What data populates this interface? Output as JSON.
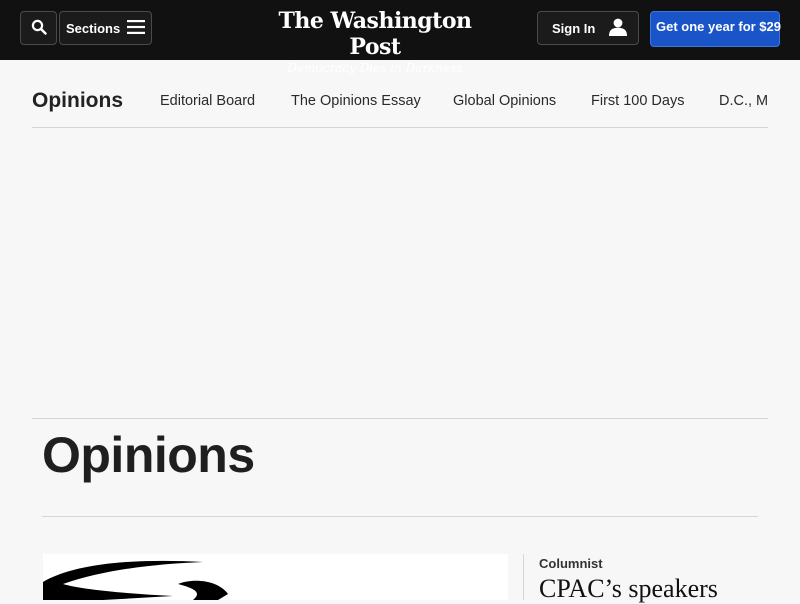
{
  "header": {
    "sections_label": "Sections",
    "masthead_title": "The Washington Post",
    "masthead_tagline": "Democracy Dies in Darkness",
    "sign_in_label": "Sign In",
    "subscribe_label": "Get one year for $29"
  },
  "subnav": {
    "title": "Opinions",
    "links": [
      "Editorial Board",
      "The Opinions Essay",
      "Global Opinions",
      "First 100 Days",
      "D.C., M"
    ]
  },
  "main": {
    "heading": "Opinions",
    "lead_story": {
      "kicker": "Columnist",
      "headline": "CPAC’s speakers"
    }
  },
  "colors": {
    "topbar": "#111111",
    "accent_blue": "#1955c9",
    "background": "#f7f7f7"
  },
  "icons": [
    "search-icon",
    "menu-icon",
    "user-icon"
  ]
}
